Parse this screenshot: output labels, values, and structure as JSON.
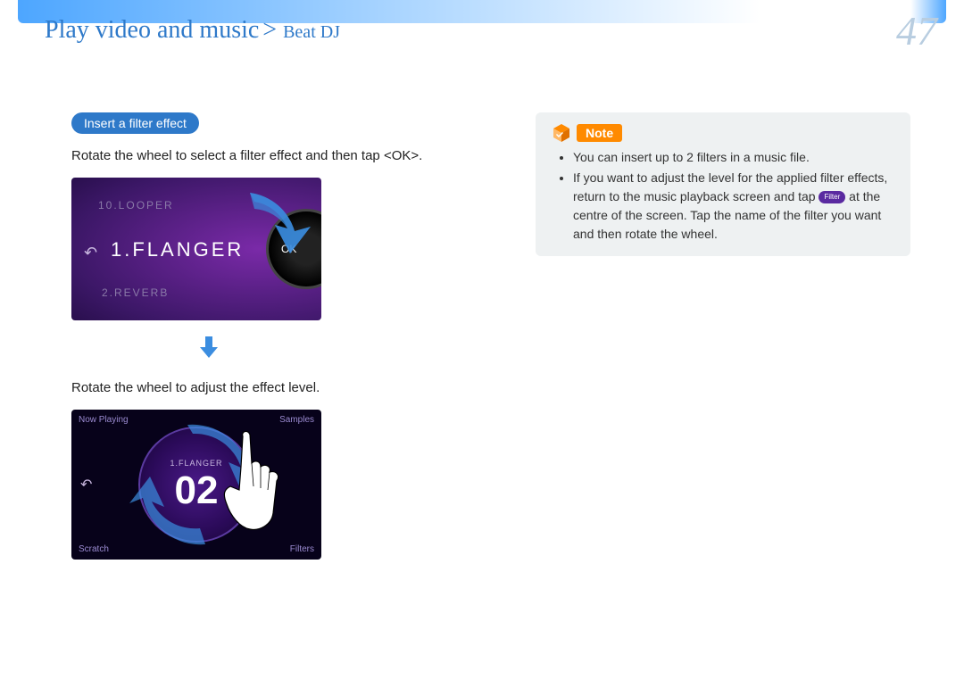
{
  "header": {
    "section": "Play video and music",
    "page": "Beat DJ",
    "pageNumber": "47"
  },
  "section": {
    "title": "Insert a filter effect"
  },
  "step1": {
    "text": "Rotate the wheel to select a filter effect and then tap <OK>.",
    "screen": {
      "prev": "10.LOOPER",
      "current": "1.FLANGER",
      "next": "2.REVERB",
      "ok": "OK"
    }
  },
  "step2": {
    "text": "Rotate the wheel to adjust the effect level.",
    "screen": {
      "topLeft": "Now Playing",
      "topRight": "Samples",
      "botLeft": "Scratch",
      "botRight": "Filters",
      "filterName": "1.FLANGER",
      "level": "02"
    }
  },
  "note": {
    "label": "Note",
    "chip": "Filter",
    "items": [
      "You can insert up to 2 filters in a music file.",
      {
        "pre": "If you want to adjust the level for the applied filter effects, return to the music playback screen and tap ",
        "post": " at the centre of the screen. Tap the name of the filter you want and then rotate the wheel."
      }
    ]
  }
}
